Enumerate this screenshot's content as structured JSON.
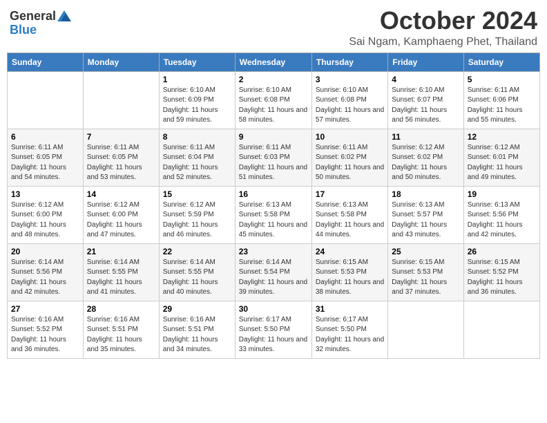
{
  "logo": {
    "general": "General",
    "blue": "Blue"
  },
  "title": {
    "month_year": "October 2024",
    "location": "Sai Ngam, Kamphaeng Phet, Thailand"
  },
  "days_of_week": [
    "Sunday",
    "Monday",
    "Tuesday",
    "Wednesday",
    "Thursday",
    "Friday",
    "Saturday"
  ],
  "weeks": [
    [
      {
        "day": "",
        "info": ""
      },
      {
        "day": "",
        "info": ""
      },
      {
        "day": "1",
        "info": "Sunrise: 6:10 AM\nSunset: 6:09 PM\nDaylight: 11 hours and 59 minutes."
      },
      {
        "day": "2",
        "info": "Sunrise: 6:10 AM\nSunset: 6:08 PM\nDaylight: 11 hours and 58 minutes."
      },
      {
        "day": "3",
        "info": "Sunrise: 6:10 AM\nSunset: 6:08 PM\nDaylight: 11 hours and 57 minutes."
      },
      {
        "day": "4",
        "info": "Sunrise: 6:10 AM\nSunset: 6:07 PM\nDaylight: 11 hours and 56 minutes."
      },
      {
        "day": "5",
        "info": "Sunrise: 6:11 AM\nSunset: 6:06 PM\nDaylight: 11 hours and 55 minutes."
      }
    ],
    [
      {
        "day": "6",
        "info": "Sunrise: 6:11 AM\nSunset: 6:05 PM\nDaylight: 11 hours and 54 minutes."
      },
      {
        "day": "7",
        "info": "Sunrise: 6:11 AM\nSunset: 6:05 PM\nDaylight: 11 hours and 53 minutes."
      },
      {
        "day": "8",
        "info": "Sunrise: 6:11 AM\nSunset: 6:04 PM\nDaylight: 11 hours and 52 minutes."
      },
      {
        "day": "9",
        "info": "Sunrise: 6:11 AM\nSunset: 6:03 PM\nDaylight: 11 hours and 51 minutes."
      },
      {
        "day": "10",
        "info": "Sunrise: 6:11 AM\nSunset: 6:02 PM\nDaylight: 11 hours and 50 minutes."
      },
      {
        "day": "11",
        "info": "Sunrise: 6:12 AM\nSunset: 6:02 PM\nDaylight: 11 hours and 50 minutes."
      },
      {
        "day": "12",
        "info": "Sunrise: 6:12 AM\nSunset: 6:01 PM\nDaylight: 11 hours and 49 minutes."
      }
    ],
    [
      {
        "day": "13",
        "info": "Sunrise: 6:12 AM\nSunset: 6:00 PM\nDaylight: 11 hours and 48 minutes."
      },
      {
        "day": "14",
        "info": "Sunrise: 6:12 AM\nSunset: 6:00 PM\nDaylight: 11 hours and 47 minutes."
      },
      {
        "day": "15",
        "info": "Sunrise: 6:12 AM\nSunset: 5:59 PM\nDaylight: 11 hours and 46 minutes."
      },
      {
        "day": "16",
        "info": "Sunrise: 6:13 AM\nSunset: 5:58 PM\nDaylight: 11 hours and 45 minutes."
      },
      {
        "day": "17",
        "info": "Sunrise: 6:13 AM\nSunset: 5:58 PM\nDaylight: 11 hours and 44 minutes."
      },
      {
        "day": "18",
        "info": "Sunrise: 6:13 AM\nSunset: 5:57 PM\nDaylight: 11 hours and 43 minutes."
      },
      {
        "day": "19",
        "info": "Sunrise: 6:13 AM\nSunset: 5:56 PM\nDaylight: 11 hours and 42 minutes."
      }
    ],
    [
      {
        "day": "20",
        "info": "Sunrise: 6:14 AM\nSunset: 5:56 PM\nDaylight: 11 hours and 42 minutes."
      },
      {
        "day": "21",
        "info": "Sunrise: 6:14 AM\nSunset: 5:55 PM\nDaylight: 11 hours and 41 minutes."
      },
      {
        "day": "22",
        "info": "Sunrise: 6:14 AM\nSunset: 5:55 PM\nDaylight: 11 hours and 40 minutes."
      },
      {
        "day": "23",
        "info": "Sunrise: 6:14 AM\nSunset: 5:54 PM\nDaylight: 11 hours and 39 minutes."
      },
      {
        "day": "24",
        "info": "Sunrise: 6:15 AM\nSunset: 5:53 PM\nDaylight: 11 hours and 38 minutes."
      },
      {
        "day": "25",
        "info": "Sunrise: 6:15 AM\nSunset: 5:53 PM\nDaylight: 11 hours and 37 minutes."
      },
      {
        "day": "26",
        "info": "Sunrise: 6:15 AM\nSunset: 5:52 PM\nDaylight: 11 hours and 36 minutes."
      }
    ],
    [
      {
        "day": "27",
        "info": "Sunrise: 6:16 AM\nSunset: 5:52 PM\nDaylight: 11 hours and 36 minutes."
      },
      {
        "day": "28",
        "info": "Sunrise: 6:16 AM\nSunset: 5:51 PM\nDaylight: 11 hours and 35 minutes."
      },
      {
        "day": "29",
        "info": "Sunrise: 6:16 AM\nSunset: 5:51 PM\nDaylight: 11 hours and 34 minutes."
      },
      {
        "day": "30",
        "info": "Sunrise: 6:17 AM\nSunset: 5:50 PM\nDaylight: 11 hours and 33 minutes."
      },
      {
        "day": "31",
        "info": "Sunrise: 6:17 AM\nSunset: 5:50 PM\nDaylight: 11 hours and 32 minutes."
      },
      {
        "day": "",
        "info": ""
      },
      {
        "day": "",
        "info": ""
      }
    ]
  ]
}
